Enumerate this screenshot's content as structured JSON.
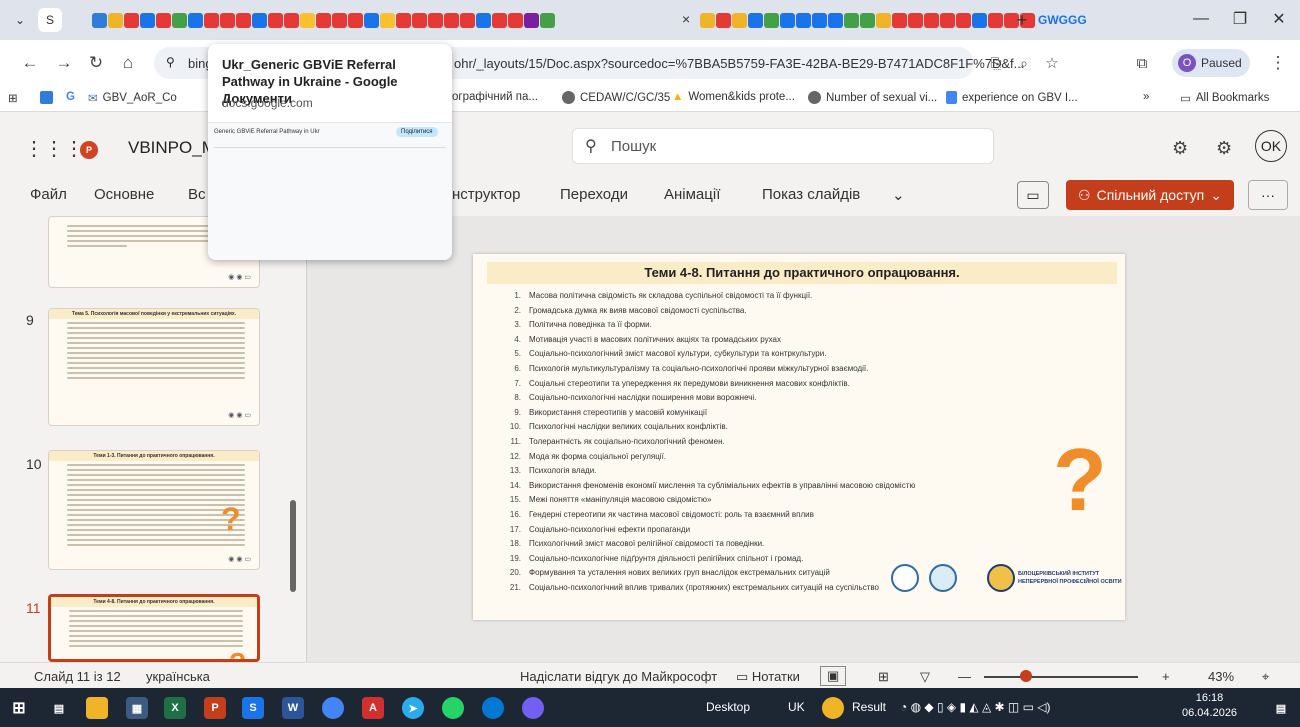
{
  "browser": {
    "tab_close": "×",
    "new_tab": "+",
    "tab_strip_text": "GWGGG",
    "window_controls": {
      "minimize": "—",
      "restore": "❐",
      "close": "✕"
    },
    "url_start": "bing",
    "url": "ohr/_layouts/15/Doc.aspx?sourcedoc=%7BBA5B5759-FA3E-42BA-BE29-B7471ADC8F1F%7D&f...",
    "profile_initial": "O",
    "profile_label": "Paused",
    "bookmarks": [
      "GBV_AoR_Co",
      "ографічний па...",
      "CEDAW/C/GC/35",
      "Women&kids prote...",
      "Number of sexual vi...",
      "experience on GBV I..."
    ],
    "bookmarks_more": "»",
    "all_bookmarks": "All Bookmarks"
  },
  "hover_card": {
    "title": "Ukr_Generic GBViE Referral Pathway in Ukraine - Google Документи",
    "domain": "docs.google.com",
    "preview_title": "Generic GBViE Referral Pathway in Ukr",
    "preview_share": "Поділитися"
  },
  "ppt": {
    "doc_name": "VBINPO_M",
    "search_placeholder": "Пошук",
    "avatar": "OK",
    "ribbon_tabs": [
      "Файл",
      "Основне",
      "Вс",
      "нструктор",
      "Переходи",
      "Анімації",
      "Показ слайдів"
    ],
    "share_label": "Спільний доступ",
    "more": "···"
  },
  "thumbnails": [
    {
      "num": "",
      "title": "",
      "lines": 5
    },
    {
      "num": "9",
      "title": "Тема 5. Психологія масової поведінки у екстремальних ситуаціях.",
      "lines": 12
    },
    {
      "num": "10",
      "title": "Теми 1-3. Питання до практичного опрацювання.",
      "lines": 18
    },
    {
      "num": "11",
      "title": "Теми 4-8. Питання до практичного опрацювання.",
      "lines": 10
    }
  ],
  "slide": {
    "title": "Теми 4-8. Питання до практичного опрацювання.",
    "question_mark": "?",
    "institute": "БІЛОЦЕРКІВСЬКИЙ ІНСТИТУТ\nНЕПЕРЕРВНОЇ ПРОФЕСІЙНОЇ ОСВІТИ",
    "items": [
      "Масова політична свідомість як складова суспільної свідомості та її функції.",
      "Громадська думка як вияв масової свідомості суспільства.",
      "Політична поведінка та її форми.",
      "Мотивація участі в масових політичних акціях та громадських рухах",
      "Соціально-психологічний зміст масової культури, субкультури та контркультури.",
      "Психологія мультикультуралізму та соціально-психологічні прояви міжкультурної взаємодії.",
      "Соціальні стереотипи та упередження як передумови виникнення масових конфліктів.",
      "Соціально-психологічні наслідки поширення мови ворожнечі.",
      "Використання стереотипів у масовій комунікації",
      "Психологічні наслідки великих соціальних конфліктів.",
      "Толерантність як соціально-психологічний феномен.",
      "Мода як форма соціальної регуляції.",
      "Психологія влади.",
      "Використання феноменів економії мислення та субліміальних ефектів в управлінні масовою свідомістю",
      "Межі поняття «маніпуляція масовою свідомістю»",
      "Гендерні стереотипи як частина масової свідомості: роль та взаємний вплив",
      "Соціально-психологічні ефекти пропаганди",
      "Психологічний зміст масової релігійної свідомості та поведінки.",
      "Соціально-психологічне підґрунтя діяльності релігійних спільнот і громад.",
      "Формування та усталення нових великих груп внаслідок екстремальних ситуацій",
      "Соціально-психологічний вплив тривалих (протяжних) екстремальних ситуацій на суспільство"
    ]
  },
  "status": {
    "slide_of": "Слайд 11 із 12",
    "language": "українська",
    "feedback": "Надіслати відгук до Майкрософт",
    "notes": "Нотатки",
    "zoom": "43%"
  },
  "taskbar": {
    "desktop": "Desktop",
    "lang": "UK",
    "result": "Result",
    "time": "16:18",
    "date": "06.04.2026"
  }
}
